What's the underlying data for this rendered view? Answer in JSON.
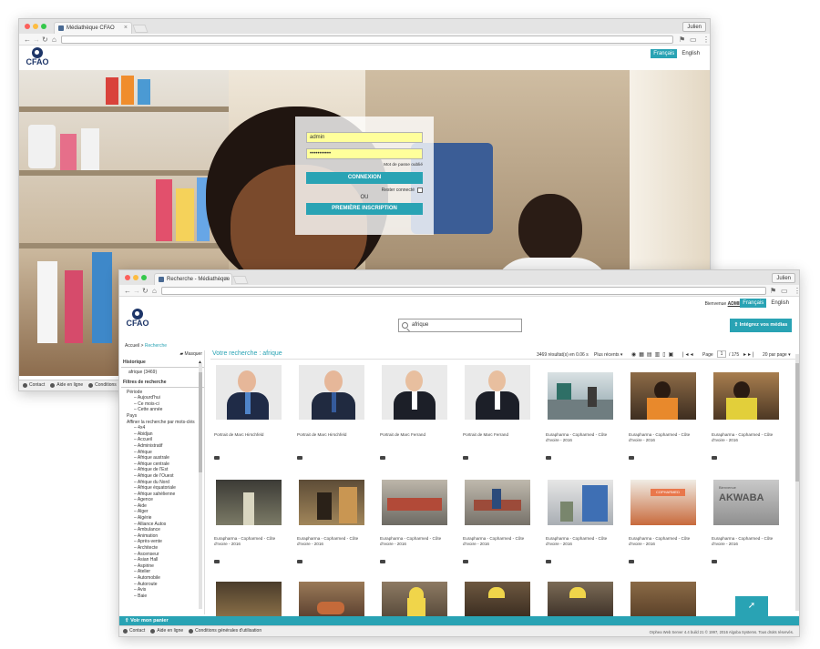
{
  "window1": {
    "tab_title": "Médiathèque CFAO",
    "user": "Julien",
    "lang_fr": "Français",
    "lang_en": "English",
    "logo": "CFAO",
    "login": {
      "username": "admin",
      "password": "•••••••••••",
      "forgot": "Mot de passe oublié",
      "connect": "CONNEXION",
      "stay": "Rester connecté",
      "or": "OU",
      "signup": "PREMIÈRE INSCRIPTION"
    },
    "footer": {
      "contact": "Contact",
      "help": "Aide en ligne",
      "terms": "Conditions"
    }
  },
  "window2": {
    "tab_title": "Recherche - Médiathèque CFA",
    "user": "Julien",
    "welcome": "Bienvenue",
    "username": "ADMIN",
    "lang_fr": "Français",
    "lang_en": "English",
    "logo": "CFAO",
    "search_value": "afrique",
    "integrate": "Intégrez vos médias",
    "breadcrumb": {
      "home": "Accueil",
      "sep": ">",
      "current": "Recherche"
    },
    "hide": "Masquer",
    "history_title": "Historique",
    "history_item": "afrique (3469)",
    "filters_title": "Filtres de recherche",
    "filters": [
      "Période",
      "– Aujourd'hui",
      "– Ce mois-ci",
      "– Cette année",
      "Pays",
      "Affiner la recherche par mots-clés",
      "– 4x4",
      "– Abidjan",
      "– Accueil",
      "– Administratif",
      "– Afrique",
      "– Afrique australe",
      "– Afrique centrale",
      "– Afrique de l'Est",
      "– Afrique de l'Ouest",
      "– Afrique du Nord",
      "– Afrique équatoriale",
      "– Afrique sahélienne",
      "– Agence",
      "– Aide",
      "– Alger",
      "– Algérie",
      "– Alliance Autos",
      "– Ambulance",
      "– Animation",
      "– Après-vente",
      "– Architecte",
      "– Ascenseur",
      "– Asian Hall",
      "– Aspirine",
      "– Atelier",
      "– Automobile",
      "– Autoroute",
      "– Avis",
      "– Baie"
    ],
    "results_title": "Votre recherche : afrique",
    "count": "3469 résultat(s) en 0.06 s",
    "sort": "Plus récents",
    "page_label": "Page",
    "page_num": "1",
    "page_total": "/ 175",
    "per_page": "20 par page",
    "row1": [
      "Portrait de Marc Hirschfeld",
      "Portrait de Marc Hirschfeld",
      "Portrait de Marc Ferrand",
      "Portrait de Marc Ferrand",
      "Eurapharma - Copharmed - Côte d'Ivoire - 2016",
      "Eurapharma - Copharmed - Côte d'Ivoire - 2016",
      "Eurapharma - Copharmed - Côte d'Ivoire - 2016"
    ],
    "row2": [
      "Eurapharma - Copharmed - Côte d'Ivoire - 2016",
      "Eurapharma - Copharmed - Côte d'Ivoire - 2016",
      "Eurapharma - Copharmed - Côte d'Ivoire - 2016",
      "Eurapharma - Copharmed - Côte d'Ivoire - 2016",
      "Eurapharma - Copharmed - Côte d'Ivoire - 2016",
      "Eurapharma - Copharmed - Côte d'Ivoire - 2016",
      "Eurapharma - Copharmed - Côte d'Ivoire - 2016"
    ],
    "akwaba_small": "Bienvenue",
    "akwaba": "AKWABA",
    "copharmed_sign": "COPHARMED",
    "basket": "Voir mon panier",
    "footer": {
      "contact": "Contact",
      "help": "Aide en ligne",
      "terms": "Conditions générales d'utilisation"
    },
    "copyright": "Orphea Web Server 4.4 build 21 © 1997, 2016 Algoba Systems. Tous droits réservés."
  },
  "colors": {
    "accent": "#29a3b4",
    "brand": "#1d3568",
    "input_fill": "#ffff9b"
  }
}
